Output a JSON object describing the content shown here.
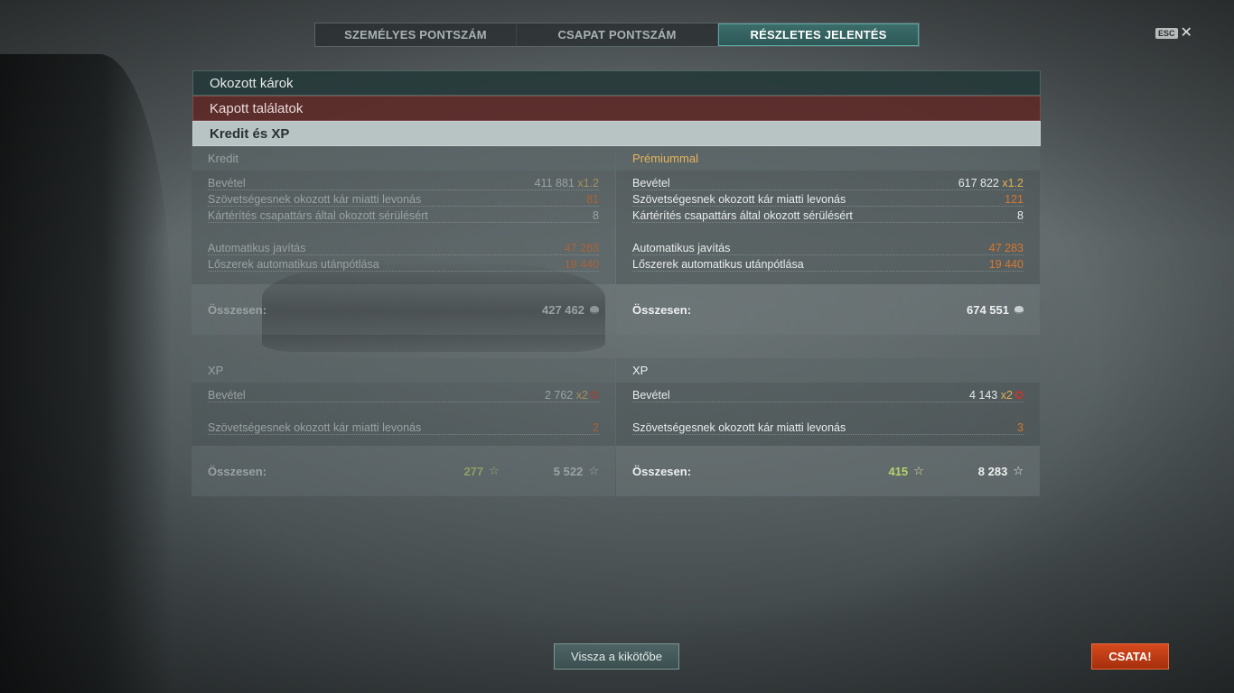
{
  "tabs": [
    {
      "label": "SZEMÉLYES PONTSZÁM"
    },
    {
      "label": "CSAPAT PONTSZÁM"
    },
    {
      "label": "RÉSZLETES JELENTÉS"
    }
  ],
  "esc": {
    "key": "ESC",
    "close": "✕"
  },
  "sections": {
    "damage": "Okozott károk",
    "hits": "Kapott találatok",
    "credit_xp": "Kredit és XP"
  },
  "credit": {
    "standard": {
      "title": "Kredit",
      "income_label": "Bevétel",
      "income_value": "411 881",
      "income_mult": "x1.2",
      "ally_damage_label": "Szövetségesnek okozott kár miatti levonás",
      "ally_damage_value": "81",
      "compensation_label": "Kártérítés csapattárs által okozott sérülésért",
      "compensation_value": "8",
      "repair_label": "Automatikus javítás",
      "repair_value": "47 283",
      "ammo_label": "Lőszerek automatikus utánpótlása",
      "ammo_value": "19 440",
      "total_label": "Összesen:",
      "total_value": "427 462"
    },
    "premium": {
      "title": "Prémiummal",
      "income_label": "Bevétel",
      "income_value": "617 822",
      "income_mult": "x1.2",
      "ally_damage_label": "Szövetségesnek okozott kár miatti levonás",
      "ally_damage_value": "121",
      "compensation_label": "Kártérítés csapattárs által okozott sérülésért",
      "compensation_value": "8",
      "repair_label": "Automatikus javítás",
      "repair_value": "47 283",
      "ammo_label": "Lőszerek automatikus utánpótlása",
      "ammo_value": "19 440",
      "total_label": "Összesen:",
      "total_value": "674 551"
    }
  },
  "xp": {
    "standard": {
      "title": "XP",
      "income_label": "Bevétel",
      "income_value": "2 762",
      "income_mult": "x2",
      "ally_damage_label": "Szövetségesnek okozott kár miatti levonás",
      "ally_damage_value": "2",
      "total_label": "Összesen:",
      "total_free_xp": "277",
      "total_value": "5 522"
    },
    "premium": {
      "title": "XP",
      "income_label": "Bevétel",
      "income_value": "4 143",
      "income_mult": "x2",
      "ally_damage_label": "Szövetségesnek okozott kár miatti levonás",
      "ally_damage_value": "3",
      "total_label": "Összesen:",
      "total_free_xp": "415",
      "total_value": "8 283"
    }
  },
  "buttons": {
    "port": "Vissza a kikötőbe",
    "battle": "CSATA!"
  },
  "colors": {
    "accent_teal": "#2d5755",
    "negative": "#d8772e",
    "premium": "#e6b45a",
    "battle_button": "#c63e16"
  }
}
